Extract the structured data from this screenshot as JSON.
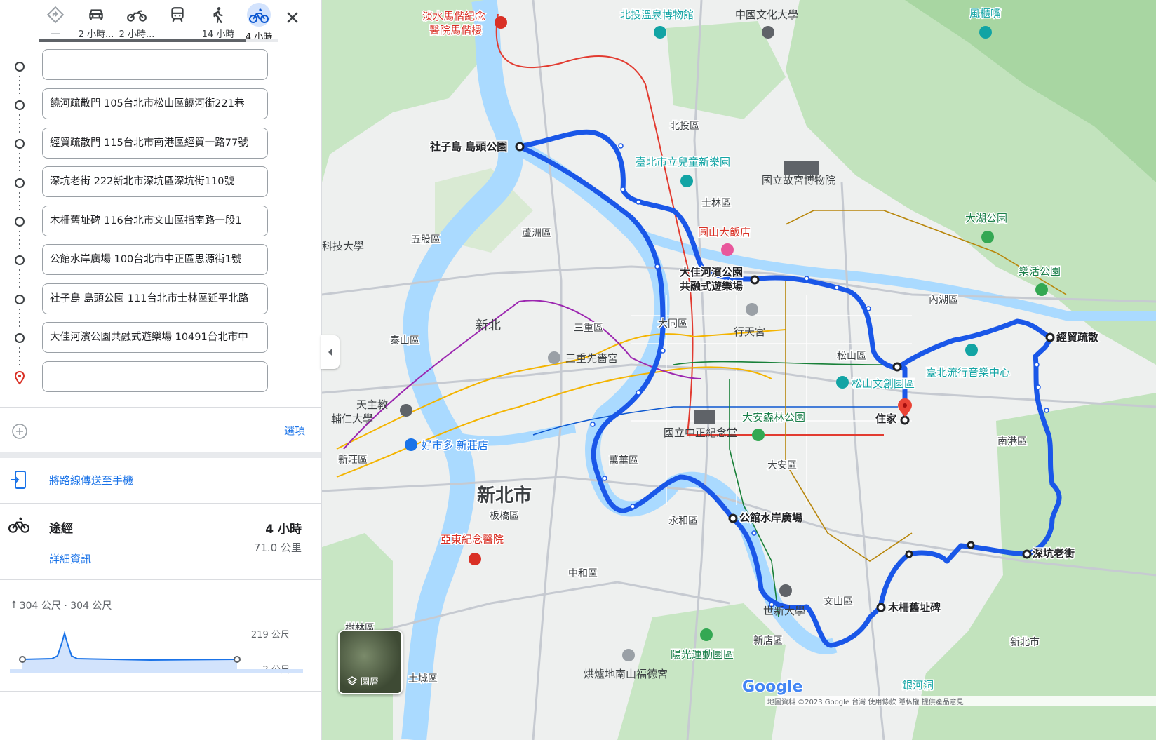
{
  "travel_modes": [
    {
      "icon": "best-route-icon",
      "label": "一",
      "active": false
    },
    {
      "icon": "car-icon",
      "label": "2 小時...",
      "active": false
    },
    {
      "icon": "motorcycle-icon",
      "label": "2 小時...",
      "active": false
    },
    {
      "icon": "transit-icon",
      "label": "",
      "active": false
    },
    {
      "icon": "walk-icon",
      "label": "14 小時",
      "active": false
    },
    {
      "icon": "bicycle-icon",
      "label": "4 小時",
      "active": true
    }
  ],
  "waypoints": [
    {
      "value": "",
      "kind": "start"
    },
    {
      "value": "饒河疏散門 105台北市松山區饒河街221巷"
    },
    {
      "value": "經貿疏散門 115台北市南港區經貿一路77號"
    },
    {
      "value": "深坑老街 222新北市深坑區深坑街110號"
    },
    {
      "value": "木柵舊址碑 116台北市文山區指南路一段1"
    },
    {
      "value": "公館水岸廣場 100台北市中正區思源街1號"
    },
    {
      "value": "社子島 島頭公園 111台北市士林區延平北路"
    },
    {
      "value": "大佳河濱公園共融式遊樂場 10491台北市中"
    },
    {
      "value": "",
      "kind": "destination"
    }
  ],
  "options_label": "選項",
  "send_to_phone": "將路線傳送至手機",
  "route": {
    "via": "途經",
    "duration": "4 小時",
    "distance": "71.0 公里",
    "details": "詳細資訊"
  },
  "elevation": {
    "summary": "304 公尺 · 304 公尺",
    "max_label": "219 公尺 —",
    "min_label": "-2 公尺 —"
  },
  "layers_label": "圖層",
  "map_labels": {
    "shezidao": "社子島 島頭公園",
    "dajia": "大佳河濱公園",
    "dajia2": "共融式遊樂場",
    "jingmao": "經貿疏散",
    "home": "住家",
    "gongguan": "公館水岸廣場",
    "muzha": "木柵舊址碑",
    "shenkeng": "深坑老街",
    "newtaipei": "新北市",
    "newtaipei2": "新北",
    "newtaipei3": "新北市",
    "shilin": "士林區",
    "beitou": "北投區",
    "songshan": "松山區",
    "neihu": "內湖區",
    "nangang": "南港區",
    "daan": "大安區",
    "datong": "大同區",
    "wanhua": "萬華區",
    "yonghe": "永和區",
    "zhonghe": "中和區",
    "banqiao": "板橋區",
    "xinzhuang": "新莊區",
    "sanchong": "三重區",
    "luzhou": "蘆洲區",
    "wugu": "五股區",
    "taishan": "泰山區",
    "xindian": "新店區",
    "wenshan": "文山區",
    "tucheng": "土城區",
    "shulin": "樹林區",
    "palace": "國立故宮博物院",
    "grandhotel": "圓山大飯店",
    "cks": "國立中正紀念堂",
    "daanpark": "大安森林公園",
    "songshanpark": "松山文創園區",
    "popmusic": "臺北流行音樂中心",
    "xingtian": "行天宮",
    "childpark": "臺北市立兒童新樂園",
    "beitoumuseum": "北投溫泉博物館",
    "wenhua": "中國文化大學",
    "mackay": "淡水馬偕紀念",
    "mackay2": "醫院馬偕樓",
    "fengguizui": "風櫃嘴",
    "dahu": "大湖公園",
    "lequ": "樂活公園",
    "yadong": "亞東紀念醫院",
    "costco": "好市多 新莊店",
    "sanchongtemple": "三重先嗇宮",
    "fujen": "天主教",
    "fujen2": "輔仁大學",
    "yangguang": "陽光運動園區",
    "shixin": "世新大學",
    "yindong": "銀河洞",
    "hongshu": "烘爐地南山福德宮",
    "tech": "科技大學",
    "google": "Google",
    "footer": "地圖資料 ©2023 Google 台灣 使用條款 隱私權 提供產品意見"
  }
}
